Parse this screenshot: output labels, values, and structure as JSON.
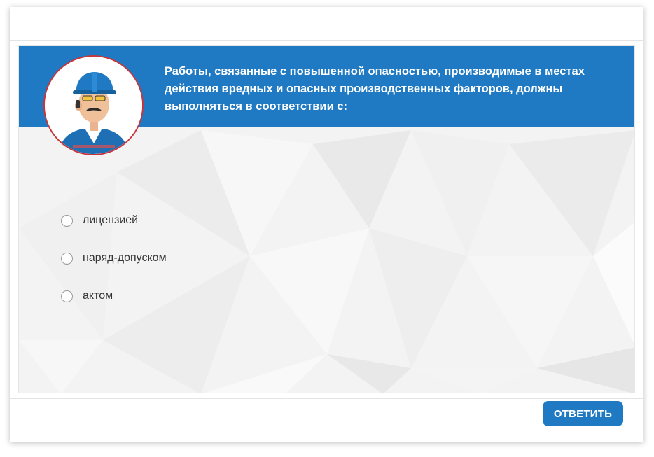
{
  "question": {
    "text": "Работы, связанные с повышенной опасностью, производимые в местах действия вредных и опасных производственных факторов, должны выполняться в соответствии с:"
  },
  "options": [
    {
      "label": "лицензией",
      "selected": false
    },
    {
      "label": "наряд-допуском",
      "selected": false
    },
    {
      "label": "актом",
      "selected": false
    }
  ],
  "actions": {
    "submit_label": "ОТВЕТИТЬ"
  },
  "colors": {
    "accent": "#1f7ac3",
    "avatar_border": "#c8363b"
  },
  "icons": {
    "avatar": "worker-avatar-icon"
  }
}
